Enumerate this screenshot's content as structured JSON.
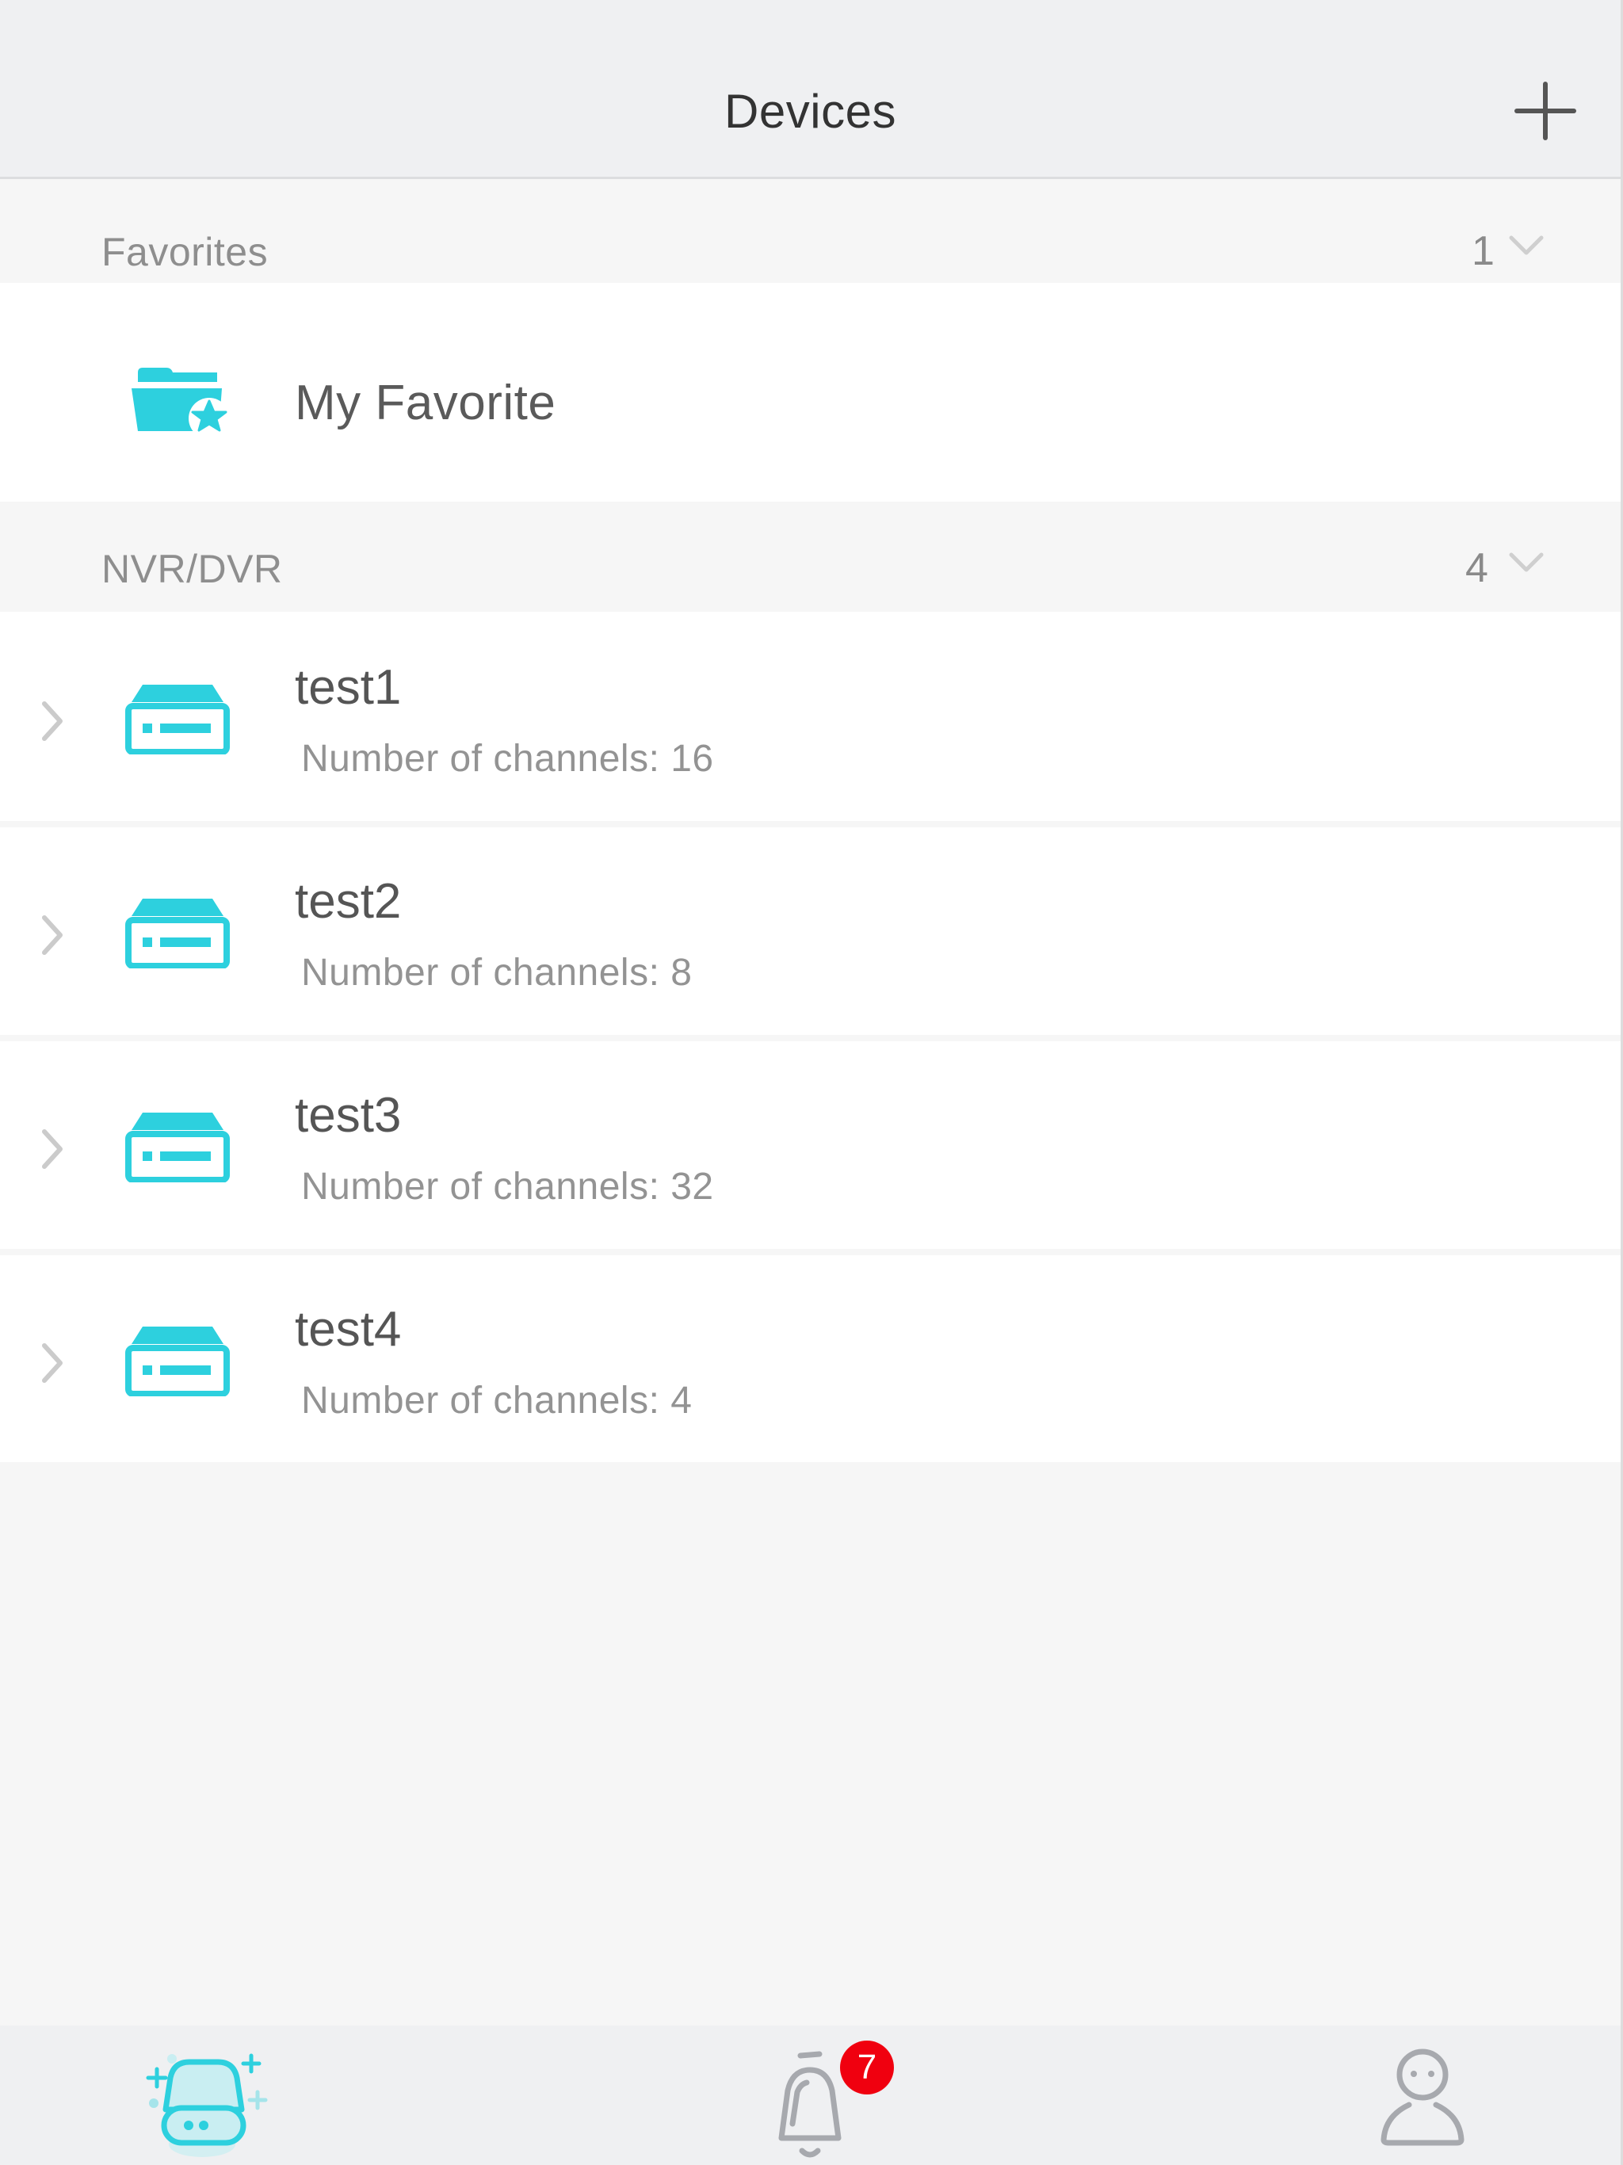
{
  "nav": {
    "title": "Devices",
    "add_icon": "plus-icon"
  },
  "sections": {
    "favorites": {
      "title": "Favorites",
      "count": "1",
      "chevron_icon": "chevron-down-icon",
      "items": [
        {
          "label": "My Favorite",
          "icon": "folder-star-icon"
        }
      ]
    },
    "nvr": {
      "title": "NVR/DVR",
      "count": "4",
      "chevron_icon": "chevron-down-icon",
      "devices": [
        {
          "name": "test1",
          "channels": "Number of channels: 16",
          "icon": "nvr-device-icon",
          "expand_icon": "chevron-right-icon"
        },
        {
          "name": "test2",
          "channels": "Number of channels: 8",
          "icon": "nvr-device-icon",
          "expand_icon": "chevron-right-icon"
        },
        {
          "name": "test3",
          "channels": "Number of channels: 32",
          "icon": "nvr-device-icon",
          "expand_icon": "chevron-right-icon"
        },
        {
          "name": "test4",
          "channels": "Number of channels: 4",
          "icon": "nvr-device-icon",
          "expand_icon": "chevron-right-icon"
        }
      ]
    }
  },
  "tabbar": {
    "tabs": [
      {
        "name": "devices",
        "icon": "device-tab-icon",
        "active": true
      },
      {
        "name": "alarms",
        "icon": "bell-icon",
        "badge": "7"
      },
      {
        "name": "me",
        "icon": "user-icon"
      }
    ]
  },
  "colors": {
    "accent": "#2DD0DE",
    "badge": "#F0000F",
    "inactive_icon": "#A7A9AE"
  }
}
